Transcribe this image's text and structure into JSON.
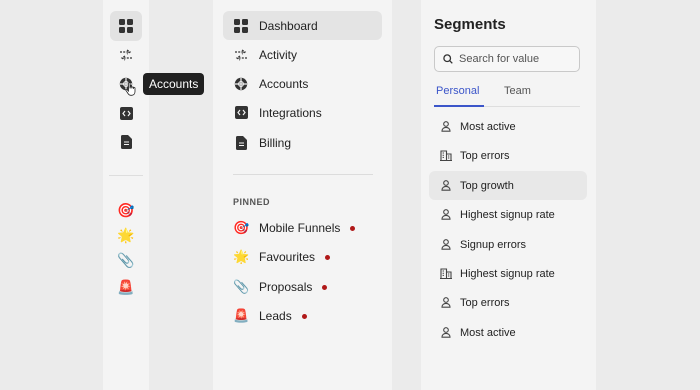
{
  "tooltip": {
    "text": "Accounts"
  },
  "rail": {
    "items": [
      {
        "icon": "dashboard-icon"
      },
      {
        "icon": "activity-icon"
      },
      {
        "icon": "accounts-icon"
      },
      {
        "icon": "integrations-icon"
      },
      {
        "icon": "billing-icon"
      }
    ],
    "pins": [
      {
        "emoji": "🎯"
      },
      {
        "emoji": "🌟"
      },
      {
        "emoji": "📎"
      },
      {
        "emoji": "🚨"
      }
    ]
  },
  "sidebar": {
    "items": [
      {
        "label": "Dashboard",
        "icon": "dashboard-icon"
      },
      {
        "label": "Activity",
        "icon": "activity-icon"
      },
      {
        "label": "Accounts",
        "icon": "accounts-icon"
      },
      {
        "label": "Integrations",
        "icon": "integrations-icon"
      },
      {
        "label": "Billing",
        "icon": "billing-icon"
      }
    ],
    "pinned_label": "PINNED",
    "pinned": [
      {
        "label": "Mobile Funnels",
        "emoji": "🎯"
      },
      {
        "label": "Favourites",
        "emoji": "🌟"
      },
      {
        "label": "Proposals",
        "emoji": "📎"
      },
      {
        "label": "Leads",
        "emoji": "🚨"
      }
    ]
  },
  "segments": {
    "title": "Segments",
    "search_placeholder": "Search for value",
    "tabs": [
      "Personal",
      "Team"
    ],
    "items": [
      {
        "label": "Most active",
        "icon": "person-icon"
      },
      {
        "label": "Top errors",
        "icon": "building-icon"
      },
      {
        "label": "Top growth",
        "icon": "person-icon"
      },
      {
        "label": "Highest signup rate",
        "icon": "person-icon"
      },
      {
        "label": "Signup errors",
        "icon": "person-icon"
      },
      {
        "label": "Highest signup rate",
        "icon": "building-icon"
      },
      {
        "label": "Top errors",
        "icon": "person-icon"
      },
      {
        "label": "Most active",
        "icon": "person-icon"
      }
    ]
  },
  "colors": {
    "accent": "#3b55c9",
    "pin_dot": "#b01818",
    "tooltip_bg": "#202020"
  }
}
